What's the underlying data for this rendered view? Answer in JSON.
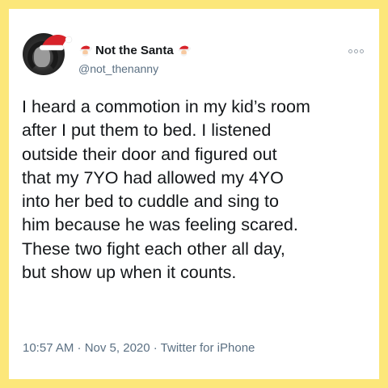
{
  "tweet": {
    "display_name": "Not the Santa",
    "handle": "@not_thenanny",
    "text": "I heard a commotion in my kid’s room\nafter I put them to bed. I listened\noutside their door and figured out\nthat my 7YO had allowed my 4YO\ninto her bed to cuddle and sing to\nhim because he was feeling scared.\nThese two fight each other all day,\nbut show up when it counts.",
    "meta": "10:57 AM · Nov 5, 2020 · Twitter for iPhone",
    "icons": {
      "name_prefix": "santa-emoji",
      "name_suffix": "santa-emoji",
      "menu": "more-options-icon"
    }
  },
  "colors": {
    "frame": "#fce77a",
    "text": "#14171a",
    "secondary": "#5b7083"
  }
}
